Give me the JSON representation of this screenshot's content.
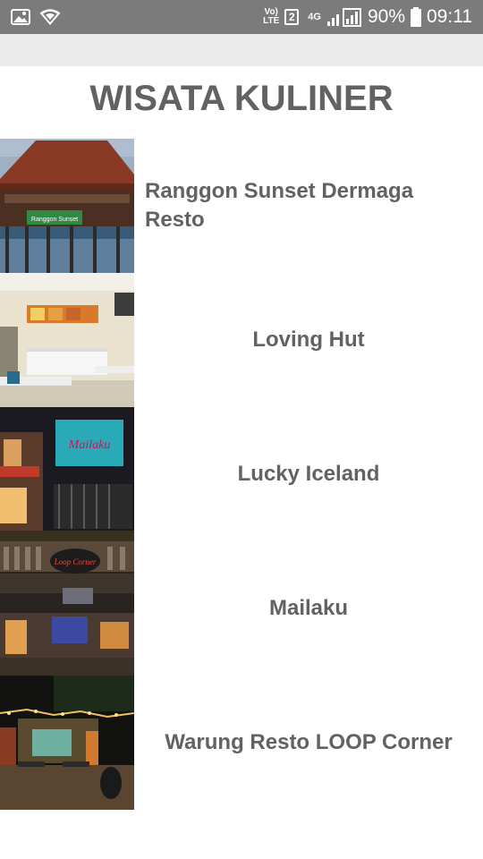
{
  "status_bar": {
    "volte_top": "Vo)",
    "volte_bottom": "LTE",
    "sim_slot": "2",
    "network": "4G",
    "battery": "90%",
    "time": "09:11",
    "icons": [
      "image-icon",
      "wifi-icon",
      "signal-icon",
      "battery-icon"
    ]
  },
  "page": {
    "title": "WISATA KULINER"
  },
  "restaurants": [
    {
      "name": "Ranggon Sunset Dermaga Resto",
      "sign_text": "Ranggon Sunset"
    },
    {
      "name": "Loving Hut"
    },
    {
      "name": "Lucky Iceland",
      "sign_text": "Mailaku"
    },
    {
      "name": "Mailaku",
      "sign_text": "Loop Corner"
    },
    {
      "name": "Warung Resto LOOP Corner"
    }
  ]
}
